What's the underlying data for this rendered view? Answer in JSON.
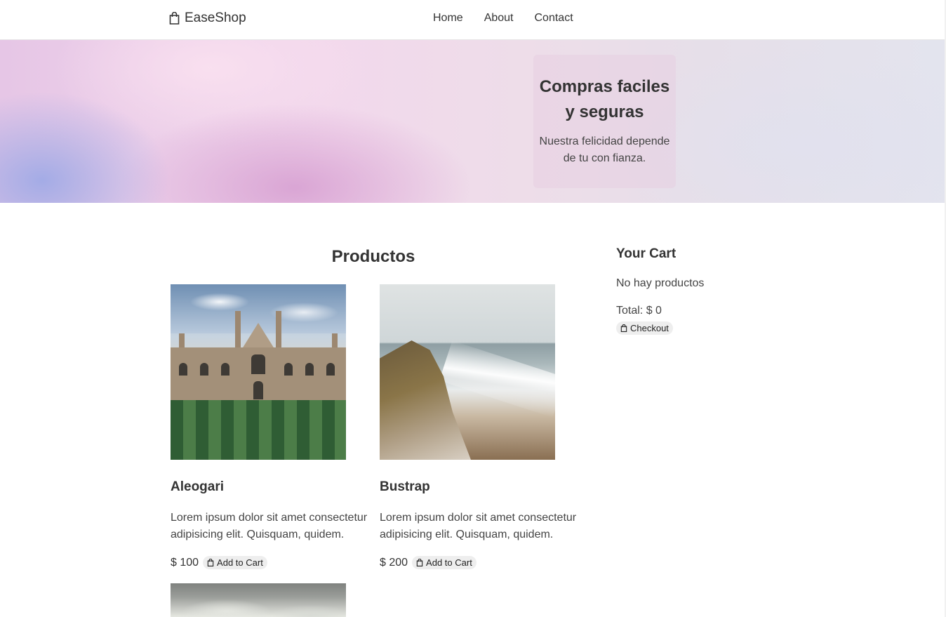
{
  "navbar": {
    "brand": "EaseShop",
    "links": [
      "Home",
      "About",
      "Contact"
    ]
  },
  "hero": {
    "title": "Compras faciles y seguras",
    "subtitle": "Nuestra felicidad depende de tu con fianza."
  },
  "products": {
    "title": "Productos",
    "items": [
      {
        "name": "Aleogari",
        "description": "Lorem ipsum dolor sit amet consectetur adipisicing elit. Quisquam, quidem.",
        "price": "$ 100",
        "button_label": "Add to Cart",
        "image": "college-building-photo"
      },
      {
        "name": "Bustrap",
        "description": "Lorem ipsum dolor sit amet consectetur adipisicing elit. Quisquam, quidem.",
        "price": "$ 200",
        "button_label": "Add to Cart",
        "image": "coastal-cliff-photo"
      },
      {
        "image": "cloudy-sky-photo"
      }
    ]
  },
  "cart": {
    "title": "Your Cart",
    "empty_text": "No hay productos",
    "total": "Total: $ 0",
    "checkout_label": "Checkout"
  },
  "icons": {
    "brand": "shopping-bag-icon",
    "button": "shopping-bag-icon"
  }
}
